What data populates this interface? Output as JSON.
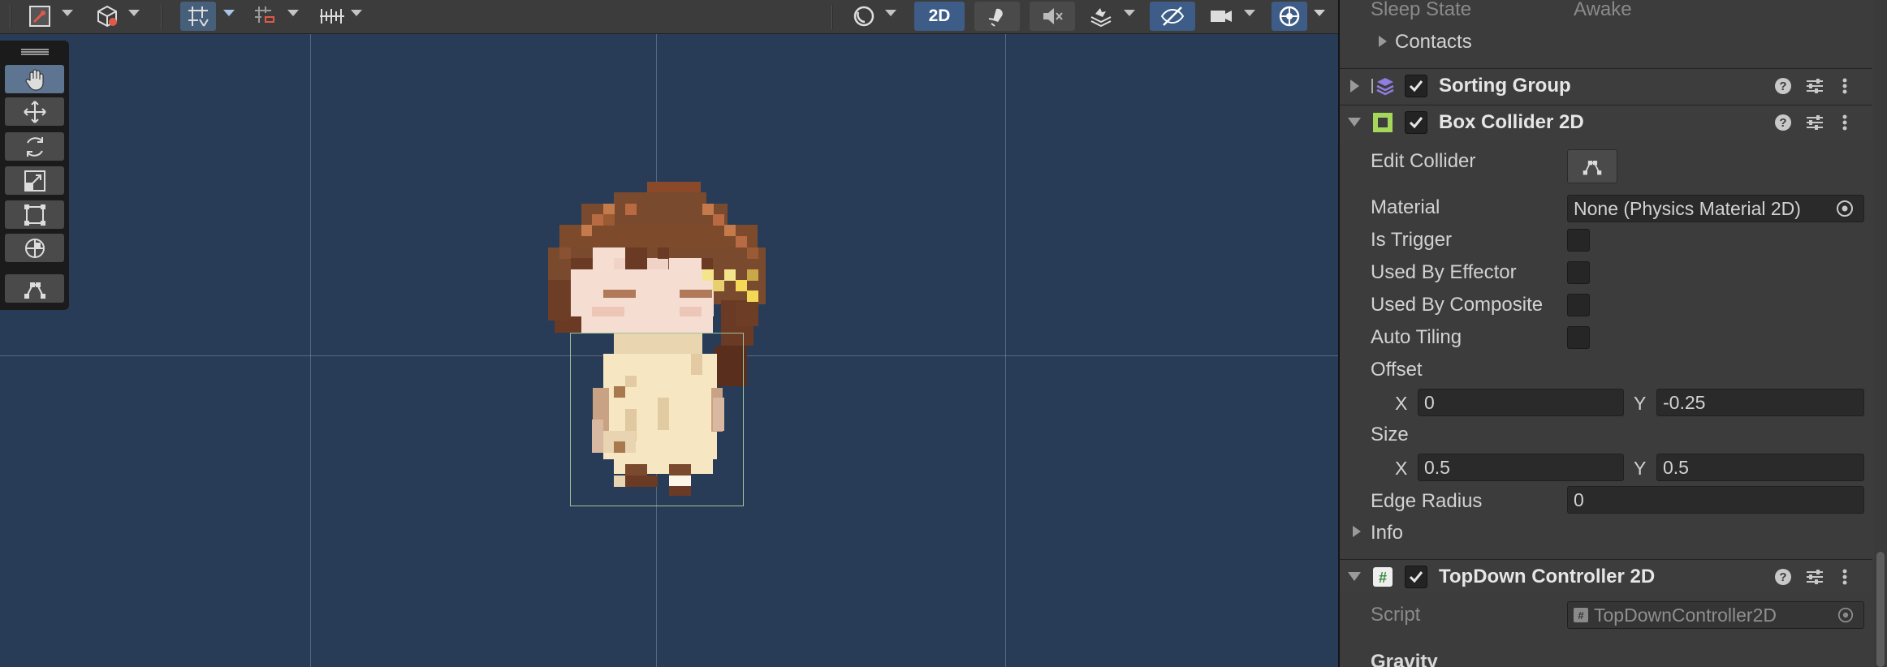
{
  "scene": {
    "toolbar": {
      "view_2d_label": "2D"
    },
    "tools": [
      "hand-tool",
      "move-tool",
      "rotate-tool",
      "scale-tool",
      "rect-tool",
      "transform-tool",
      "edit-collider-tool"
    ],
    "selected_tool": "hand-tool",
    "colors": {
      "background": "#283c58",
      "collider": "#9ec49a"
    }
  },
  "inspector": {
    "rigidbody_tail": {
      "sleep_state_label": "Sleep State",
      "sleep_state_value": "Awake",
      "contacts_label": "Contacts"
    },
    "sorting_group": {
      "title": "Sorting Group",
      "enabled": true
    },
    "box_collider": {
      "title": "Box Collider 2D",
      "enabled": true,
      "edit_collider_label": "Edit Collider",
      "material_label": "Material",
      "material_value": "None (Physics Material 2D)",
      "is_trigger_label": "Is Trigger",
      "used_by_effector_label": "Used By Effector",
      "used_by_composite_label": "Used By Composite",
      "auto_tiling_label": "Auto Tiling",
      "offset_label": "Offset",
      "offset_x_label": "X",
      "offset_x": "0",
      "offset_y_label": "Y",
      "offset_y": "-0.25",
      "size_label": "Size",
      "size_x_label": "X",
      "size_x": "0.5",
      "size_y_label": "Y",
      "size_y": "0.5",
      "edge_radius_label": "Edge Radius",
      "edge_radius": "0",
      "info_label": "Info"
    },
    "topdown_controller": {
      "title": "TopDown Controller 2D",
      "enabled": true,
      "script_label": "Script",
      "script_value": "TopDownController2D",
      "gravity_label": "Gravity"
    }
  }
}
